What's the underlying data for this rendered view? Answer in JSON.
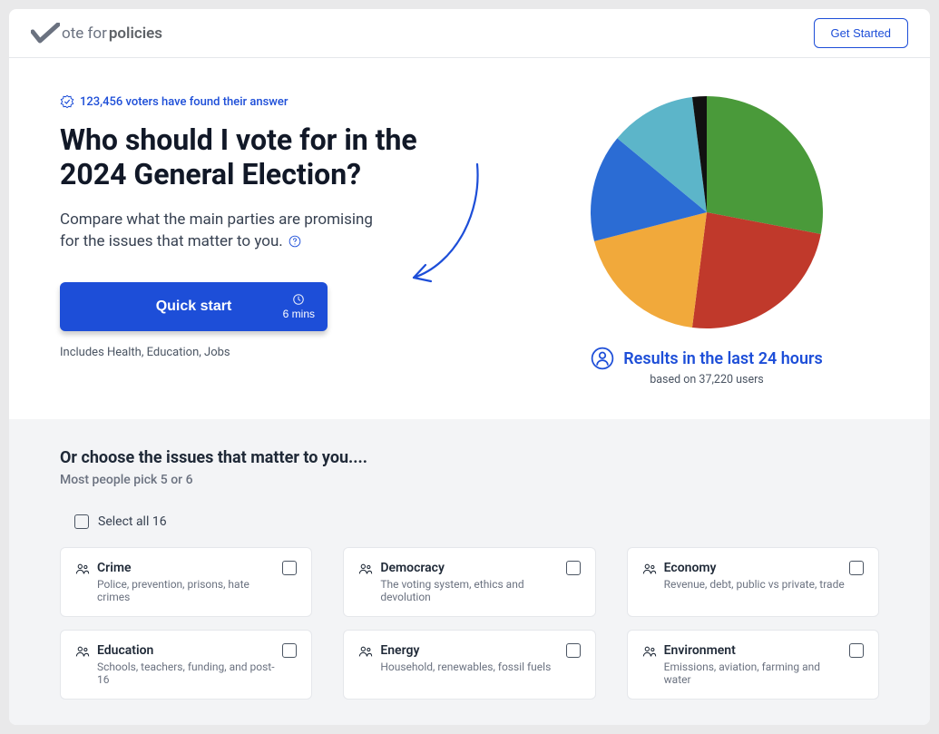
{
  "header": {
    "logo_pre": "ote for ",
    "logo_bold": "policies",
    "cta": "Get Started"
  },
  "hero": {
    "badge": "123,456 voters have found their answer",
    "title": "Who should I vote for in the 2024 General Election?",
    "sub": "Compare what the main parties are promising for the issues that matter to you.",
    "quick_label": "Quick start",
    "quick_time": "6 mins",
    "includes": "Includes Health, Education, Jobs"
  },
  "results": {
    "headline": "Results in the last 24 hours",
    "sub": "based on 37,220 users"
  },
  "chart_data": {
    "type": "pie",
    "title": "Results in the last 24 hours",
    "values": [
      {
        "name": "green",
        "value": 28,
        "color": "#4a9a3a"
      },
      {
        "name": "red",
        "value": 24,
        "color": "#c0392b"
      },
      {
        "name": "yellow",
        "value": 19,
        "color": "#f1a93b"
      },
      {
        "name": "blue",
        "value": 15,
        "color": "#2b6cd4"
      },
      {
        "name": "lightblue",
        "value": 12,
        "color": "#5cb5c9"
      },
      {
        "name": "black",
        "value": 2,
        "color": "#111"
      }
    ]
  },
  "issues": {
    "title": "Or choose the issues that matter to you....",
    "sub": "Most people pick 5 or 6",
    "select_all": "Select all 16",
    "cards": [
      {
        "title": "Crime",
        "desc": "Police, prevention, prisons, hate crimes"
      },
      {
        "title": "Democracy",
        "desc": "The voting system, ethics and devolution"
      },
      {
        "title": "Economy",
        "desc": "Revenue, debt, public vs private, trade"
      },
      {
        "title": "Education",
        "desc": "Schools, teachers, funding, and post-16"
      },
      {
        "title": "Energy",
        "desc": "Household, renewables, fossil fuels"
      },
      {
        "title": "Environment",
        "desc": "Emissions, aviation, farming and water"
      }
    ]
  }
}
